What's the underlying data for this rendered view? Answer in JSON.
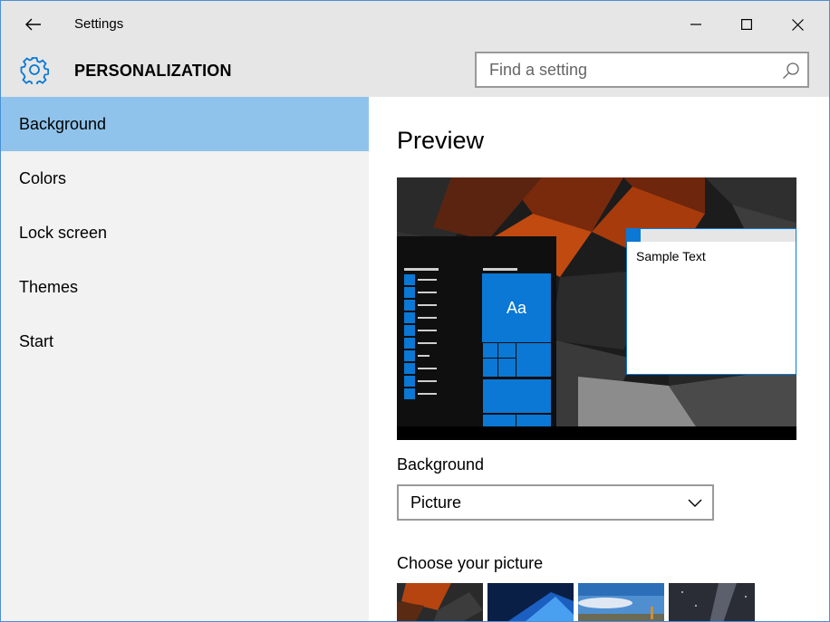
{
  "window": {
    "app_title": "Settings",
    "page_title": "PERSONALIZATION",
    "accent_color": "#0a78d4",
    "selection_color": "#8fc3eb"
  },
  "search": {
    "placeholder": "Find a setting",
    "value": ""
  },
  "sidebar": {
    "items": [
      {
        "label": "Background",
        "active": true
      },
      {
        "label": "Colors",
        "active": false
      },
      {
        "label": "Lock screen",
        "active": false
      },
      {
        "label": "Themes",
        "active": false
      },
      {
        "label": "Start",
        "active": false
      }
    ]
  },
  "main": {
    "preview_title": "Preview",
    "preview_tile_text": "Aa",
    "preview_sample_text": "Sample Text",
    "background_label": "Background",
    "background_value": "Picture",
    "choose_picture_label": "Choose your picture"
  },
  "icons": {
    "back": "back-arrow-icon",
    "settings": "gear-icon",
    "search": "search-icon",
    "dropdown": "chevron-down-icon",
    "minimize": "minimize-icon",
    "maximize": "maximize-icon",
    "close": "close-icon"
  }
}
